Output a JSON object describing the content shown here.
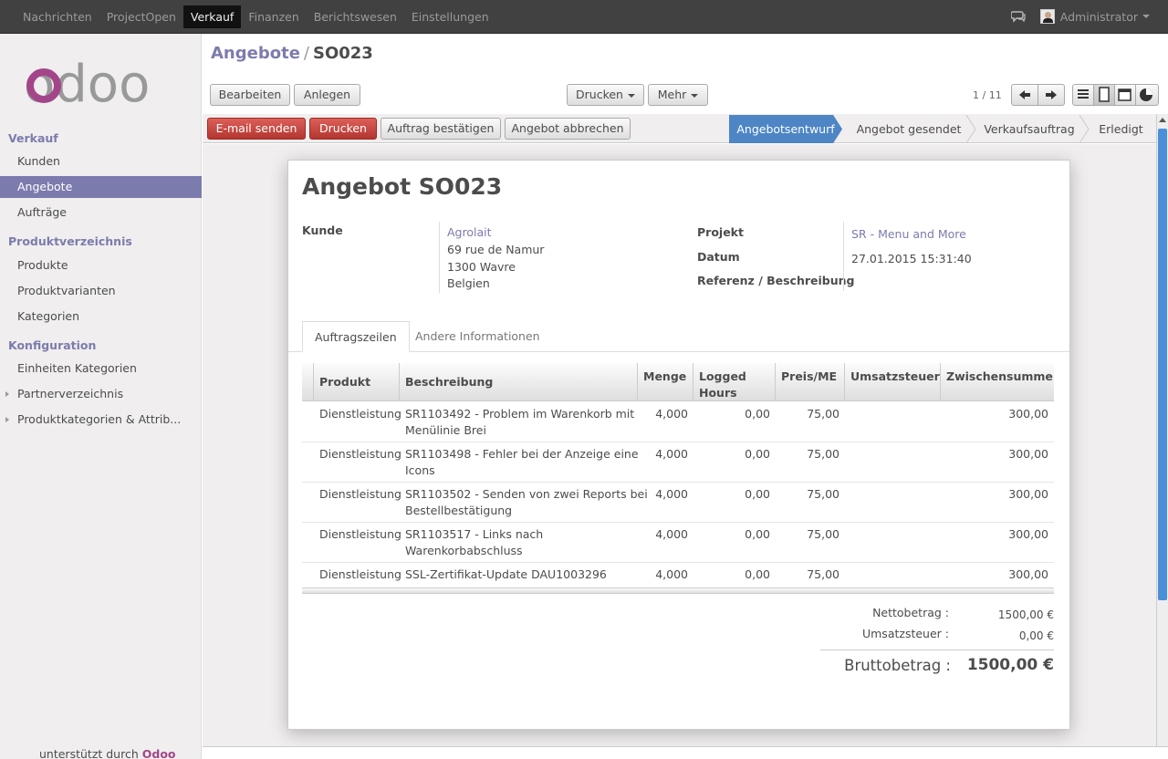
{
  "topbar": {
    "menu": [
      "Nachrichten",
      "ProjectOpen",
      "Verkauf",
      "Finanzen",
      "Berichtswesen",
      "Einstellungen"
    ],
    "active_menu": "Verkauf",
    "user": "Administrator"
  },
  "sidebar": {
    "logo": "odoo",
    "sections": [
      {
        "title": "Verkauf",
        "items": [
          "Kunden",
          "Angebote",
          "Aufträge"
        ]
      },
      {
        "title": "Produktverzeichnis",
        "items": [
          "Produkte",
          "Produktvarianten",
          "Kategorien"
        ]
      },
      {
        "title": "Konfiguration",
        "items": [
          "Einheiten Kategorien",
          "Partnerverzeichnis",
          "Produktkategorien & Attrib..."
        ]
      }
    ],
    "active_item": "Angebote",
    "powered_prefix": "unterstützt durch",
    "powered_brand": "Odoo"
  },
  "breadcrumb": {
    "parent": "Angebote",
    "separator": "/",
    "current": "SO023"
  },
  "toolbar": {
    "edit": "Bearbeiten",
    "create": "Anlegen",
    "print_menu": "Drucken",
    "more_menu": "Mehr",
    "pager": "1 / 11"
  },
  "actions": {
    "send_email": "E-mail senden",
    "print": "Drucken",
    "confirm": "Auftrag bestätigen",
    "cancel": "Angebot abbrechen"
  },
  "stages": [
    "Angebotsentwurf",
    "Angebot gesendet",
    "Verkaufsauftrag",
    "Erledigt"
  ],
  "active_stage": "Angebotsentwurf",
  "form": {
    "title_prefix": "Angebot",
    "title_number": "SO023",
    "customer_label": "Kunde",
    "customer_name": "Agrolait",
    "customer_address": [
      "69 rue de Namur",
      "1300 Wavre",
      "Belgien"
    ],
    "project_label": "Projekt",
    "project_value": "SR - Menu and More",
    "date_label": "Datum",
    "date_value": "27.01.2015 15:31:40",
    "reference_label": "Referenz / Beschreibung"
  },
  "tabs": [
    "Auftragszeilen",
    "Andere Informationen"
  ],
  "table": {
    "headers": {
      "product": "Produkt",
      "description": "Beschreibung",
      "quantity": "Menge",
      "logged_1": "Logged",
      "logged_2": "Hours",
      "price": "Preis/ME",
      "tax": "Umsatzsteuer",
      "subtotal": "Zwischensumme"
    },
    "rows": [
      {
        "product": "Dienstleistung",
        "desc1": "SR1103492 - Problem im Warenkorb mit",
        "desc2": "Menülinie Brei",
        "qty": "4,000",
        "logged": "0,00",
        "price": "75,00",
        "tax": "",
        "subtotal": "300,00"
      },
      {
        "product": "Dienstleistung",
        "desc1": "SR1103498 - Fehler bei der Anzeige eine",
        "desc2": "Icons",
        "qty": "4,000",
        "logged": "0,00",
        "price": "75,00",
        "tax": "",
        "subtotal": "300,00"
      },
      {
        "product": "Dienstleistung",
        "desc1": "SR1103502 - Senden von zwei Reports bei",
        "desc2": "Bestellbestätigung",
        "qty": "4,000",
        "logged": "0,00",
        "price": "75,00",
        "tax": "",
        "subtotal": "300,00"
      },
      {
        "product": "Dienstleistung",
        "desc1": "SR1103517 - Links nach",
        "desc2": "Warenkorbabschluss",
        "qty": "4,000",
        "logged": "0,00",
        "price": "75,00",
        "tax": "",
        "subtotal": "300,00"
      },
      {
        "product": "Dienstleistung",
        "desc1": "SSL-Zertifikat-Update DAU1003296",
        "desc2": "",
        "qty": "4,000",
        "logged": "0,00",
        "price": "75,00",
        "tax": "",
        "subtotal": "300,00"
      }
    ]
  },
  "totals": {
    "net_label": "Nettobetrag :",
    "net_value": "1500,00 €",
    "tax_label": "Umsatzsteuer :",
    "tax_value": "0,00 €",
    "gross_label": "Bruttobetrag :",
    "gross_value": "1500,00 €"
  },
  "colors": {
    "accent": "#7c7bad",
    "stage_active": "#4d85c5",
    "danger": "#c9302c",
    "brand": "#a24689"
  }
}
